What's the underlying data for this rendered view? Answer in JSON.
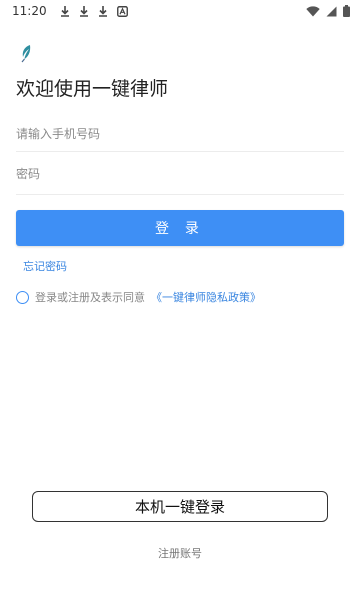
{
  "status_bar": {
    "time": "11:20"
  },
  "title": "欢迎使用一键律师",
  "phone_input": {
    "placeholder": "请输入手机号码",
    "value": ""
  },
  "password_input": {
    "placeholder": "密码",
    "value": ""
  },
  "login_button": "登 录",
  "forgot_password": "忘记密码",
  "agreement": {
    "text": "登录或注册及表示同意",
    "policy_link": "《一键律师隐私政策》"
  },
  "local_login_button": "本机一键登录",
  "register_link": "注册账号",
  "colors": {
    "primary": "#3e8ff5",
    "link": "#3a86e0"
  }
}
